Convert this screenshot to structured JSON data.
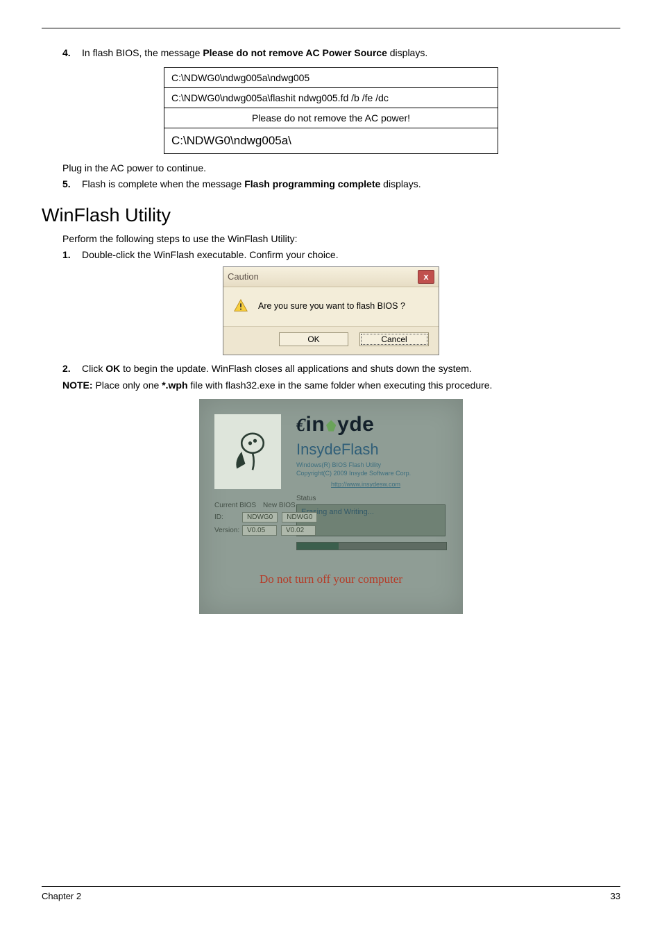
{
  "step4": {
    "num": "4.",
    "text_before": "In flash BIOS, the message ",
    "bold": "Please do not remove AC Power Source",
    "text_after": " displays."
  },
  "dos_box": {
    "line1": "C:\\NDWG0\\ndwg005a\\ndwg005",
    "line2": "C:\\NDWG0\\ndwg005a\\flashit ndwg005.fd /b /fe /dc",
    "line3": "Please do not remove the AC power!",
    "line4": "C:\\NDWG0\\ndwg005a\\"
  },
  "plug_text": "Plug in the AC power to continue.",
  "step5": {
    "num": "5.",
    "text_before": "Flash is complete when the message ",
    "bold": "Flash programming complete",
    "text_after": " displays."
  },
  "section_title": "WinFlash Utility",
  "perform_text": "Perform the following steps to use the WinFlash Utility:",
  "step1b": {
    "num": "1.",
    "text": "Double-click the WinFlash executable.  Confirm your choice."
  },
  "caution_dialog": {
    "title": "Caution",
    "close": "x",
    "message": "Are you sure you want to flash BIOS ?",
    "ok": "OK",
    "cancel": "Cancel"
  },
  "step2b": {
    "num": "2.",
    "text_before": "Click ",
    "bold": "OK",
    "text_after": " to begin the update. WinFlash closes all applications and shuts down the system."
  },
  "note": {
    "label": "NOTE:",
    "text_before": " Place only one ",
    "bold": "*.wph",
    "text_after": " file with flash32.exe in the same folder when executing this procedure."
  },
  "flash_shot": {
    "brand_left": "in",
    "brand_right": "yde",
    "title2": "InsydeFlash",
    "sub1": "Windows(R) BIOS Flash Utility",
    "sub2": "Copyright(C) 2009 Insyde Software Corp.",
    "sub3": "http://www.insydesw.com",
    "status_label": "Status",
    "status_text": "Erasing and Writing...",
    "current_label": "Current BIOS",
    "new_label": "New BIOS",
    "id_label": "ID:",
    "id_cur": "NDWG0",
    "id_new": "NDWG0",
    "ver_label": "Version:",
    "ver_cur": "V0.05",
    "ver_new": "V0.02",
    "warn": "Do not turn off your computer"
  },
  "footer": {
    "left": "Chapter 2",
    "right": "33"
  }
}
